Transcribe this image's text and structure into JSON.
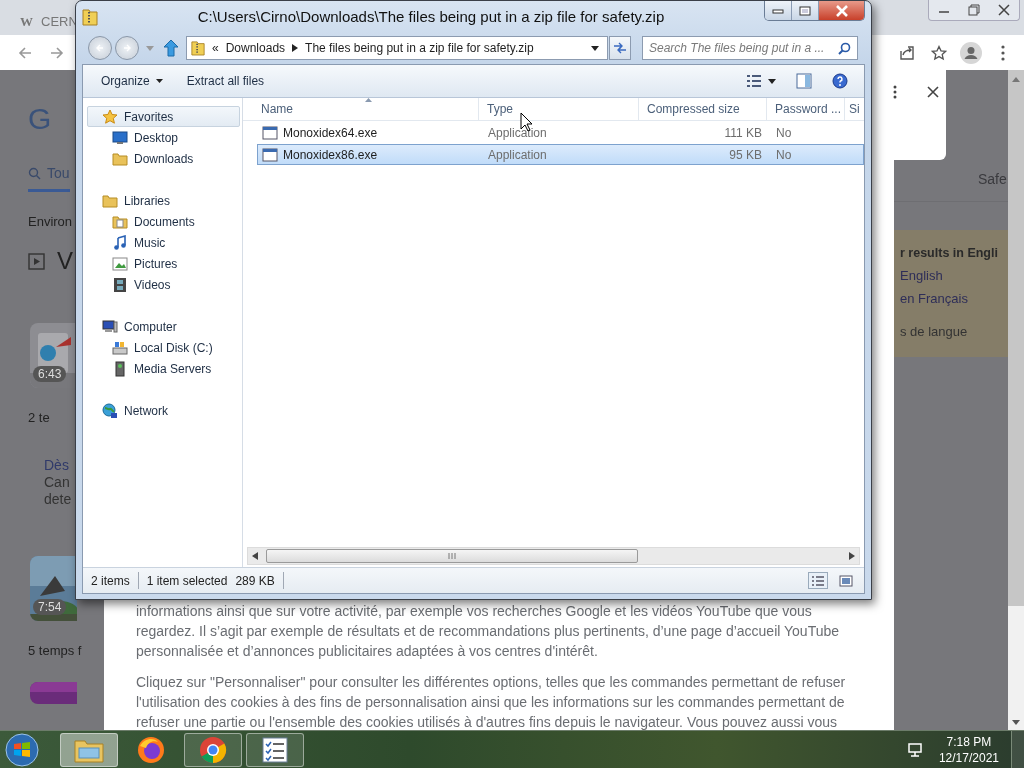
{
  "browser": {
    "tab": {
      "favicon": "W",
      "title": "CERN"
    },
    "left_results": [
      {
        "kind": "logo",
        "text": "G"
      },
      {
        "kind": "search_tab",
        "text": "Tou",
        "selected": true
      },
      {
        "kind": "label",
        "text": "Environ"
      },
      {
        "kind": "heading",
        "text": "V"
      },
      {
        "kind": "thumbnail",
        "duration": "6:43"
      },
      {
        "kind": "label",
        "text": "2 te"
      },
      {
        "kind": "snippet",
        "lines": [
          "Dès",
          "Can",
          "dete"
        ]
      },
      {
        "kind": "thumbnail",
        "duration": "7:54"
      },
      {
        "kind": "label",
        "text": "5 temps f"
      },
      {
        "kind": "thumbnail"
      }
    ],
    "filter_label": "Safe",
    "language_box": {
      "title": "r results in Engli",
      "links": [
        "English",
        "en Français"
      ],
      "settings": "s de langue"
    },
    "consent_paragraphs": [
      "informations ainsi que sur votre activité, par exemple vos recherches Google et les vidéos YouTube que vous regardez. Il s’agit par exemple de résultats et de recommandations plus pertinents, d’une page d’accueil YouTube personnalisée et d’annonces publicitaires adaptées à vos centres d'intérêt.",
      "Cliquez sur \"Personnaliser\" pour consulter les différentes options, telles que les commandes permettant de refuser l'utilisation des cookies à des fins de personnalisation ainsi que les informations sur les commandes permettant de refuser une partie ou l'ensemble des cookies utilisés à d'autres fins depuis le navigateur. Vous pouvez aussi vous"
    ]
  },
  "explorer": {
    "title": "C:\\Users\\Cirno\\Downloads\\The files being put in a zip file for safety.zip",
    "address": {
      "overflow": "«",
      "segments": [
        "Downloads",
        "The files being put in a zip file for safety.zip"
      ]
    },
    "search": {
      "placeholder": "Search The files being put in a ..."
    },
    "commands": [
      "Organize",
      "Extract all files"
    ],
    "nav": [
      {
        "label": "Favorites",
        "kind": "star",
        "selected": true,
        "children": [
          {
            "label": "Desktop",
            "kind": "desktop",
            "selected": false
          },
          {
            "label": "Downloads",
            "kind": "downloads",
            "selected": false
          }
        ]
      },
      {
        "label": "Libraries",
        "kind": "library",
        "selected": false,
        "children": [
          {
            "label": "Documents",
            "kind": "document",
            "selected": false
          },
          {
            "label": "Music",
            "kind": "music",
            "selected": false
          },
          {
            "label": "Pictures",
            "kind": "picture",
            "selected": false
          },
          {
            "label": "Videos",
            "kind": "video",
            "selected": false
          }
        ]
      },
      {
        "label": "Computer",
        "kind": "computer",
        "selected": false,
        "children": [
          {
            "label": "Local Disk (C:)",
            "kind": "drive",
            "selected": false
          },
          {
            "label": "Media Servers",
            "kind": "media",
            "selected": false
          }
        ]
      },
      {
        "label": "Network",
        "kind": "network",
        "selected": false
      }
    ],
    "columns": [
      "Name",
      "Type",
      "Compressed size",
      "Password ...",
      "Si"
    ],
    "files": [
      {
        "name": "Monoxidex64.exe",
        "type": "Application",
        "size": "111 KB",
        "password": "No",
        "selected": false
      },
      {
        "name": "Monoxidex86.exe",
        "type": "Application",
        "size": "95 KB",
        "password": "No",
        "selected": true
      }
    ],
    "status": {
      "count": "2 items",
      "selection": "1 item selected",
      "size": "289 KB"
    }
  },
  "taskbar": {
    "apps": [
      {
        "kind": "explorer",
        "running": true,
        "selected": true
      },
      {
        "kind": "firefox",
        "running": false,
        "selected": false
      },
      {
        "kind": "chrome",
        "running": true,
        "selected": false
      },
      {
        "kind": "tasks",
        "running": true,
        "selected": false
      }
    ],
    "time": "7:18 PM",
    "date": "12/17/2021"
  }
}
